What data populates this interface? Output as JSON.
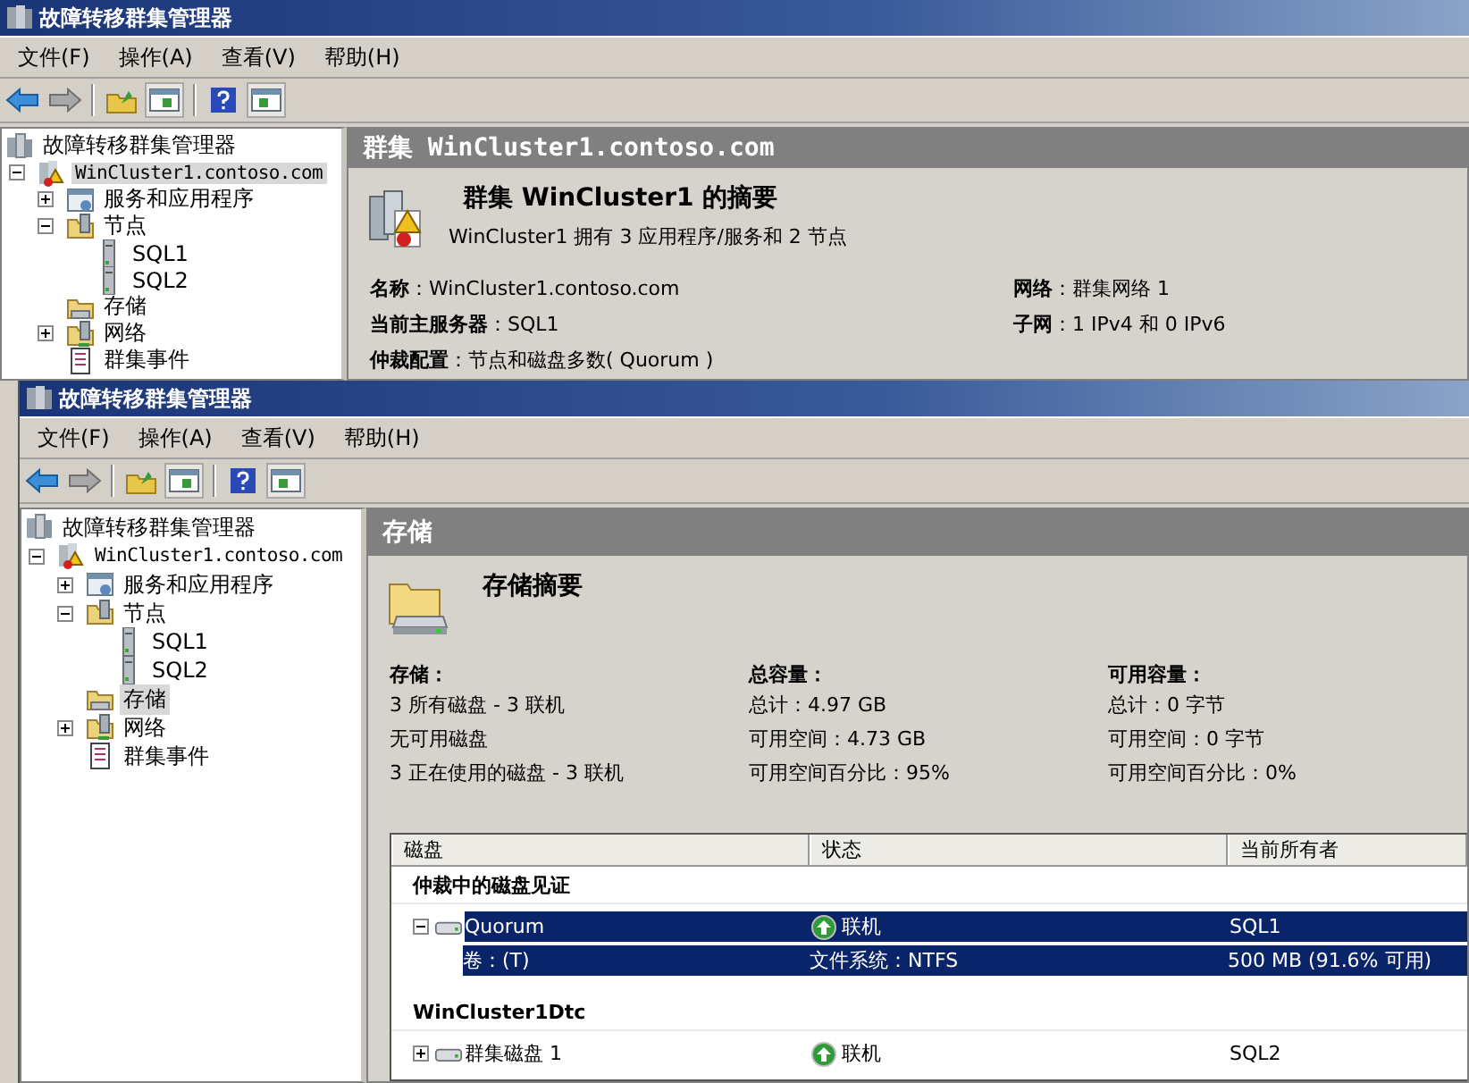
{
  "back_window": {
    "title": "故障转移群集管理器",
    "menu": [
      "文件(F)",
      "操作(A)",
      "查看(V)",
      "帮助(H)"
    ],
    "tree": [
      {
        "label": "故障转移群集管理器",
        "kind": "manager",
        "selected": false,
        "children": [
          {
            "label": "WinCluster1.contoso.com",
            "kind": "cluster",
            "selected": true,
            "expanded": true,
            "children": [
              {
                "label": "服务和应用程序",
                "kind": "services",
                "selected": false,
                "expanded": false
              },
              {
                "label": "节点",
                "kind": "nodes",
                "selected": false,
                "expanded": true,
                "children": [
                  {
                    "label": "SQL1",
                    "kind": "server",
                    "selected": false
                  },
                  {
                    "label": "SQL2",
                    "kind": "server",
                    "selected": false
                  }
                ]
              },
              {
                "label": "存储",
                "kind": "storage",
                "selected": false
              },
              {
                "label": "网络",
                "kind": "network",
                "selected": false,
                "expanded": false
              },
              {
                "label": "群集事件",
                "kind": "events",
                "selected": false
              }
            ]
          }
        ]
      }
    ],
    "detail": {
      "kind": "cluster",
      "header": "群集 WinCluster1.contoso.com",
      "summary_title": "群集 WinCluster1 的摘要",
      "summary_text": "WinCluster1 拥有 3 应用程序/服务和 2 节点",
      "columns": [
        {
          "lines": [
            "**名称**：WinCluster1.contoso.com",
            "**当前主服务器**：SQL1",
            "**仲裁配置**：节点和磁盘多数( Quorum )"
          ]
        },
        {
          "lines": [
            "**网络**：群集网络 1",
            "**子网**：1 IPv4 和 0 IPv6"
          ]
        }
      ]
    }
  },
  "front_window": {
    "title": "故障转移群集管理器",
    "menu": [
      "文件(F)",
      "操作(A)",
      "查看(V)",
      "帮助(H)"
    ],
    "tree": [
      {
        "label": "故障转移群集管理器",
        "kind": "manager",
        "selected": false,
        "children": [
          {
            "label": "WinCluster1.contoso.com",
            "kind": "cluster",
            "selected": false,
            "expanded": true,
            "children": [
              {
                "label": "服务和应用程序",
                "kind": "services",
                "selected": false,
                "expanded": false
              },
              {
                "label": "节点",
                "kind": "nodes",
                "selected": false,
                "expanded": true,
                "children": [
                  {
                    "label": "SQL1",
                    "kind": "server",
                    "selected": false
                  },
                  {
                    "label": "SQL2",
                    "kind": "server",
                    "selected": false
                  }
                ]
              },
              {
                "label": "存储",
                "kind": "storage",
                "selected": true
              },
              {
                "label": "网络",
                "kind": "network",
                "selected": false,
                "expanded": false
              },
              {
                "label": "群集事件",
                "kind": "events",
                "selected": false
              }
            ]
          }
        ]
      }
    ],
    "detail": {
      "kind": "storage",
      "header": "存储",
      "summary_title": "存储摘要",
      "columns": [
        {
          "heading": "存储：",
          "lines": [
            "3 所有磁盘 - 3 联机",
            "无可用磁盘",
            "3 正在使用的磁盘 - 3 联机"
          ]
        },
        {
          "heading": "总容量：",
          "lines": [
            "总计：4.97 GB",
            "可用空间：4.73 GB",
            "可用空间百分比：95%"
          ]
        },
        {
          "heading": "可用容量：",
          "lines": [
            "总计：0 字节",
            "可用空间：0 字节",
            "可用空间百分比：0%"
          ]
        }
      ],
      "table": {
        "columns": [
          "磁盘",
          "状态",
          "当前所有者"
        ],
        "groups": [
          {
            "title": "仲裁中的磁盘见证",
            "rows": [
              {
                "kind": "disk",
                "name": "Quorum",
                "status": "联机",
                "owner": "SQL1",
                "expanded": true,
                "selected": true
              },
              {
                "kind": "volume",
                "name": "卷：(T)",
                "status": "文件系统：NTFS",
                "owner": "500 MB (91.6% 可用)",
                "selected": true
              }
            ]
          },
          {
            "title": "WinCluster1Dtc",
            "rows": [
              {
                "kind": "disk",
                "name": "群集磁盘 1",
                "status": "联机",
                "owner": "SQL2",
                "expanded": false,
                "selected": false
              }
            ]
          }
        ]
      }
    }
  }
}
